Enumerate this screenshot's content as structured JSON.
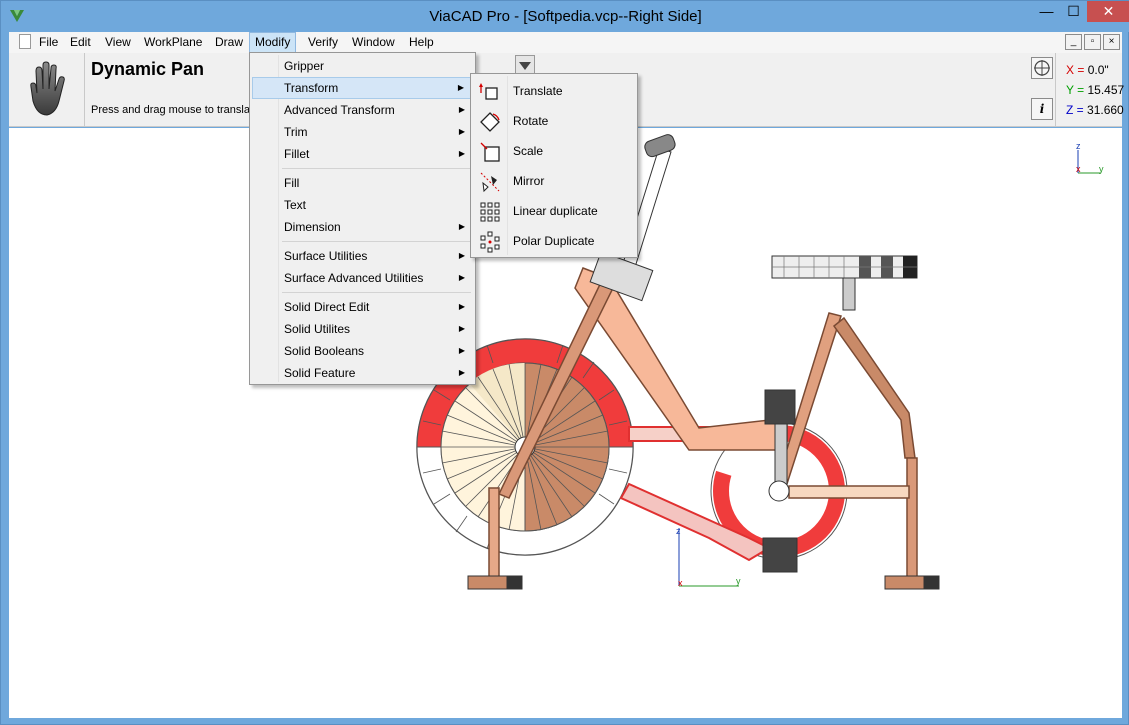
{
  "window": {
    "title": "ViaCAD Pro - [Softpedia.vcp--Right Side]",
    "controls": {
      "minimize": "—",
      "maximize": "☐",
      "close": "✕"
    }
  },
  "menubar": {
    "items": [
      "File",
      "Edit",
      "View",
      "WorkPlane",
      "Draw",
      "Modify",
      "Verify",
      "Window",
      "Help"
    ],
    "active": "Modify"
  },
  "toolbar": {
    "tool_title": "Dynamic Pan",
    "tool_hint": "Press and drag mouse to translate",
    "coords": {
      "x_label": "X =",
      "x_value": "0.0\"",
      "y_label": "Y =",
      "y_value": "15.457",
      "z_label": "Z =",
      "z_value": "31.660"
    },
    "info_button": "i"
  },
  "modify_menu": {
    "items": [
      {
        "label": "Gripper",
        "submenu": false
      },
      {
        "label": "Transform",
        "submenu": true,
        "highlighted": true
      },
      {
        "label": "Advanced Transform",
        "submenu": true
      },
      {
        "label": "Trim",
        "submenu": true
      },
      {
        "label": "Fillet",
        "submenu": true
      },
      {
        "label": "Fill",
        "submenu": false
      },
      {
        "label": "Text",
        "submenu": false
      },
      {
        "label": "Dimension",
        "submenu": true
      },
      {
        "label": "Surface Utilities",
        "submenu": true
      },
      {
        "label": "Surface Advanced Utilities",
        "submenu": true
      },
      {
        "label": "Solid Direct Edit",
        "submenu": true
      },
      {
        "label": "Solid Utilites",
        "submenu": true
      },
      {
        "label": "Solid Booleans",
        "submenu": true
      },
      {
        "label": "Solid Feature",
        "submenu": true
      }
    ]
  },
  "transform_menu": {
    "items": [
      {
        "label": "Translate",
        "icon": "translate-icon"
      },
      {
        "label": "Rotate",
        "icon": "rotate-icon"
      },
      {
        "label": "Scale",
        "icon": "scale-icon"
      },
      {
        "label": "Mirror",
        "icon": "mirror-icon"
      },
      {
        "label": "Linear duplicate",
        "icon": "linear-duplicate-icon"
      },
      {
        "label": "Polar Duplicate",
        "icon": "polar-duplicate-icon"
      }
    ]
  },
  "axis_labels": {
    "x": "x",
    "y": "y",
    "z": "z"
  },
  "colors": {
    "titlebar": "#6fa8dc",
    "close_button": "#c75050",
    "menu_highlight": "#d5e6f7",
    "wheel_red": "#f03c3c",
    "frame_tan": "#f7b899",
    "frame_brown": "#b5765a"
  }
}
